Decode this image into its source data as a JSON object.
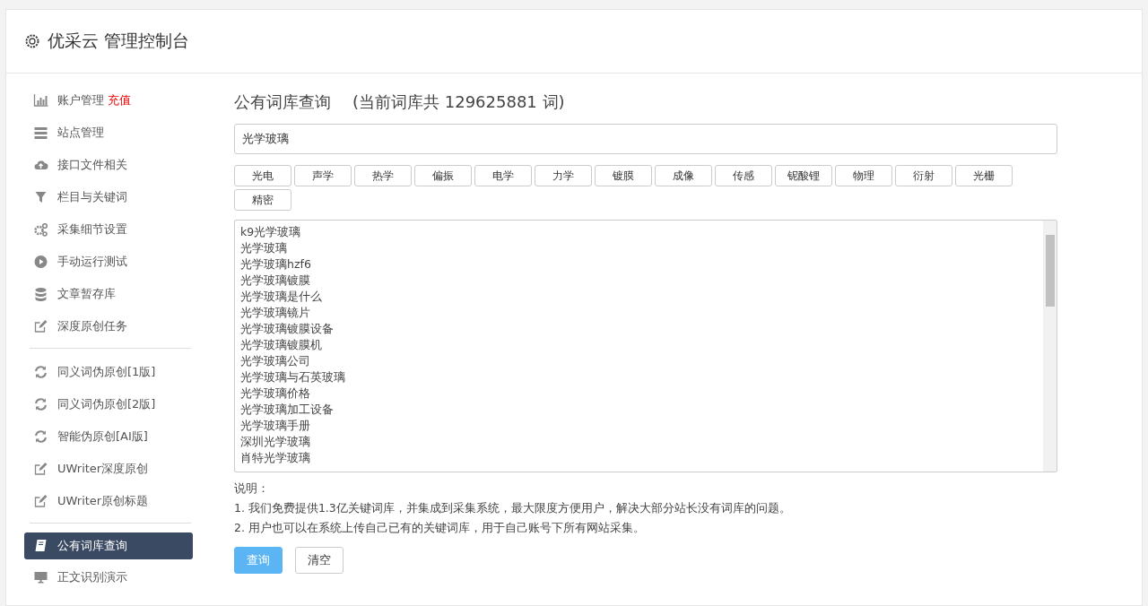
{
  "header": {
    "title": "优采云 管理控制台"
  },
  "sidebar": {
    "groups": [
      [
        {
          "label": "账户管理",
          "badge": "充值",
          "selected": false
        },
        {
          "label": "站点管理",
          "selected": false
        },
        {
          "label": "接口文件相关",
          "selected": false
        },
        {
          "label": "栏目与关键词",
          "selected": false
        },
        {
          "label": "采集细节设置",
          "selected": false
        },
        {
          "label": "手动运行测试",
          "selected": false
        },
        {
          "label": "文章暂存库",
          "selected": false
        },
        {
          "label": "深度原创任务",
          "selected": false
        }
      ],
      [
        {
          "label": "同义词伪原创[1版]",
          "selected": false
        },
        {
          "label": "同义词伪原创[2版]",
          "selected": false
        },
        {
          "label": "智能伪原创[AI版]",
          "selected": false
        },
        {
          "label": "UWriter深度原创",
          "selected": false
        },
        {
          "label": "UWriter原创标题",
          "selected": false
        }
      ],
      [
        {
          "label": "公有词库查询",
          "selected": true
        },
        {
          "label": "正文识别演示",
          "selected": false
        }
      ]
    ]
  },
  "main": {
    "title": "公有词库查询",
    "count_note": "(当前词库共 129625881 词)",
    "search": {
      "value": "光学玻璃"
    },
    "tags": [
      "光电",
      "声学",
      "热学",
      "偏振",
      "电学",
      "力学",
      "镀膜",
      "成像",
      "传感",
      "铌酸锂",
      "物理",
      "衍射",
      "光栅",
      "精密"
    ],
    "results": [
      "k9光学玻璃",
      "光学玻璃",
      "光学玻璃hzf6",
      "光学玻璃镀膜",
      "光学玻璃是什么",
      "光学玻璃镜片",
      "光学玻璃镀膜设备",
      "光学玻璃镀膜机",
      "光学玻璃公司",
      "光学玻璃与石英玻璃",
      "光学玻璃价格",
      "光学玻璃加工设备",
      "光学玻璃手册",
      "深圳光学玻璃",
      "肖特光学玻璃"
    ],
    "notes_title": "说明：",
    "notes": [
      "1. 我们免费提供1.3亿关键词库，并集成到采集系统，最大限度方便用户，解决大部分站长没有词库的问题。",
      "2. 用户也可以在系统上传自己已有的关键词库，用于自己账号下所有网站采集。"
    ],
    "buttons": [
      {
        "label": "查询",
        "kind": "primary"
      },
      {
        "label": "清空",
        "kind": "default"
      }
    ]
  }
}
